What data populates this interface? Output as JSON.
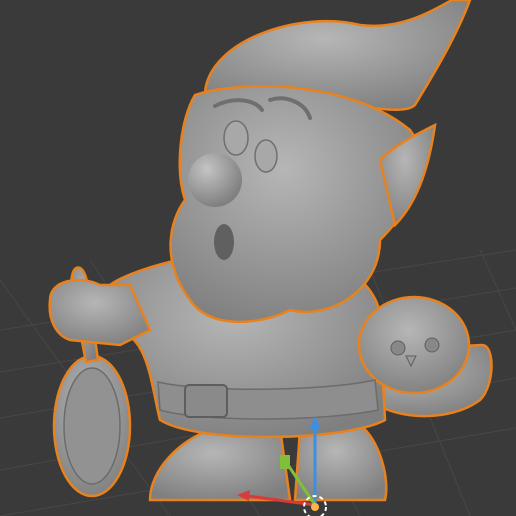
{
  "viewport": {
    "background": "#3a3a3a",
    "grid_color": "#474747",
    "selection_outline_color": "#e8821e",
    "model_color": "#9a9a9a"
  },
  "model": {
    "name_icon": "gnome-figurine",
    "selected": true,
    "props": [
      "frying-pan",
      "basket",
      "chick"
    ]
  },
  "gizmo": {
    "x_axis_color": "#d93a3a",
    "y_axis_color": "#7fbf3a",
    "z_axis_color": "#3f8fe0",
    "origin_icon": "3d-cursor-icon"
  }
}
